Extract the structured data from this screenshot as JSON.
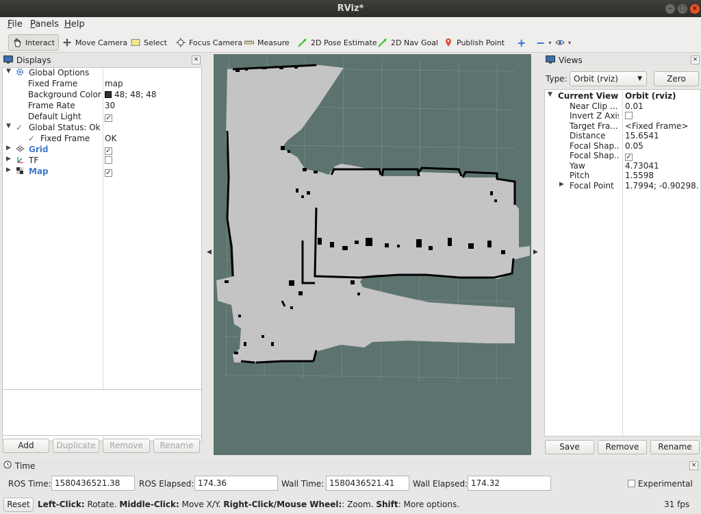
{
  "window": {
    "title": "RViz*"
  },
  "menu": [
    {
      "label": "File",
      "key": "F",
      "rest": "ile"
    },
    {
      "label": "Panels",
      "key": "P",
      "rest": "anels"
    },
    {
      "label": "Help",
      "key": "H",
      "rest": "elp"
    }
  ],
  "toolbar": {
    "interact": "Interact",
    "move_camera": "Move Camera",
    "select": "Select",
    "focus_camera": "Focus Camera",
    "measure": "Measure",
    "pose_estimate": "2D Pose Estimate",
    "nav_goal": "2D Nav Goal",
    "publish_point": "Publish Point",
    "plus": "+",
    "minus": "−"
  },
  "displays": {
    "title": "Displays",
    "global_options": "Global Options",
    "fixed_frame_label": "Fixed Frame",
    "fixed_frame_value": "map",
    "background_color_label": "Background Color",
    "background_color_value": "48; 48; 48",
    "background_color_hex": "#303030",
    "frame_rate_label": "Frame Rate",
    "frame_rate_value": "30",
    "default_light_label": "Default Light",
    "global_status": "Global Status: Ok",
    "status_fixed_frame_label": "Fixed Frame",
    "status_fixed_frame_value": "OK",
    "grid": "Grid",
    "tf": "TF",
    "map": "Map",
    "buttons": {
      "add": "Add",
      "duplicate": "Duplicate",
      "remove": "Remove",
      "rename": "Rename"
    }
  },
  "views": {
    "title": "Views",
    "type_label": "Type:",
    "type_value": "Orbit (rviz)",
    "zero": "Zero",
    "current_view_label": "Current View",
    "current_view_value": "Orbit (rviz)",
    "props": [
      {
        "label": "Near Clip ...",
        "value": "0.01"
      },
      {
        "label": "Invert Z Axis",
        "value": ""
      },
      {
        "label": "Target Fra...",
        "value": "<Fixed Frame>"
      },
      {
        "label": "Distance",
        "value": "15.6541"
      },
      {
        "label": "Focal Shap...",
        "value": "0.05"
      },
      {
        "label": "Focal Shap...",
        "value": ""
      },
      {
        "label": "Yaw",
        "value": "4.73041"
      },
      {
        "label": "Pitch",
        "value": "1.5598"
      },
      {
        "label": "Focal Point",
        "value": "1.7994; -0.90298..."
      }
    ],
    "buttons": {
      "save": "Save",
      "remove": "Remove",
      "rename": "Rename"
    }
  },
  "time": {
    "title": "Time",
    "ros_time_label": "ROS Time:",
    "ros_time": "1580436521.38",
    "ros_elapsed_label": "ROS Elapsed:",
    "ros_elapsed": "174.36",
    "wall_time_label": "Wall Time:",
    "wall_time": "1580436521.41",
    "wall_elapsed_label": "Wall Elapsed:",
    "wall_elapsed": "174.32",
    "experimental": "Experimental",
    "reset": "Reset",
    "hint_left": "Left-Click:",
    "hint_left_text": " Rotate. ",
    "hint_middle": "Middle-Click:",
    "hint_middle_text": " Move X/Y. ",
    "hint_right": "Right-Click/Mouse Wheel:",
    "hint_right_text": ": Zoom. ",
    "hint_shift": "Shift",
    "hint_shift_text": ": More options.",
    "fps": "31 fps"
  },
  "colors": {
    "viewport_bg": "#5d7370",
    "map_free": "#c4c4c4",
    "map_wall": "#000000",
    "accent_close": "#e95420"
  }
}
